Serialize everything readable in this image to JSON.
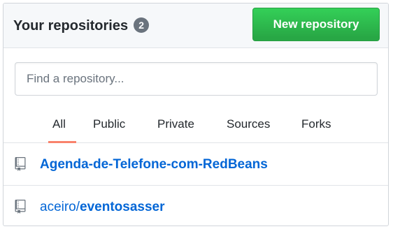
{
  "header": {
    "title": "Your repositories",
    "count": "2",
    "new_button_label": "New repository"
  },
  "search": {
    "placeholder": "Find a repository...",
    "value": ""
  },
  "tabs": [
    {
      "label": "All",
      "selected": true
    },
    {
      "label": "Public",
      "selected": false
    },
    {
      "label": "Private",
      "selected": false
    },
    {
      "label": "Sources",
      "selected": false
    },
    {
      "label": "Forks",
      "selected": false
    }
  ],
  "repositories": [
    {
      "owner": "",
      "name": "Agenda-de-Telefone-com-RedBeans",
      "icon": "repo-icon"
    },
    {
      "owner": "aceiro/",
      "name": "eventosasser",
      "icon": "repo-icon"
    }
  ],
  "colors": {
    "accent_green": "#28a745",
    "link_blue": "#0366d6",
    "tab_underline": "#f9826c",
    "counter_gray": "#6a737d"
  }
}
